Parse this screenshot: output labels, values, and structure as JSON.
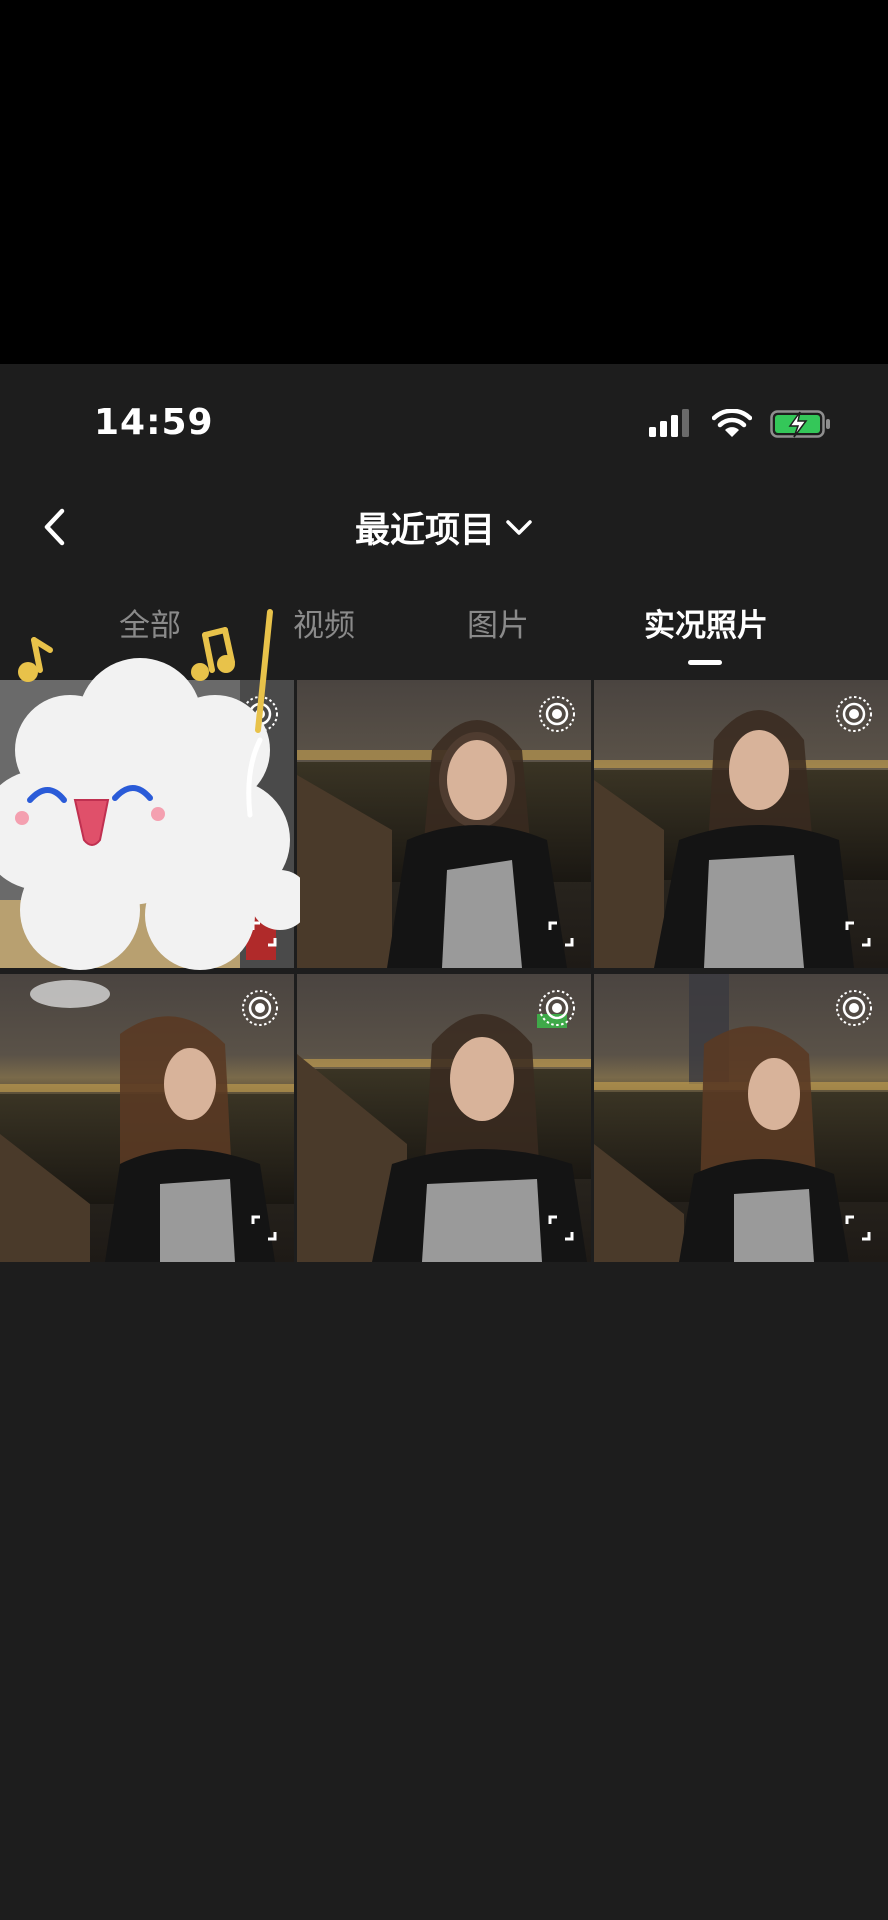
{
  "status_bar": {
    "time": "14:59",
    "icons": [
      "cellular-signal-icon",
      "wifi-icon",
      "battery-charging-icon"
    ],
    "battery_color": "#34c759"
  },
  "nav": {
    "back_icon": "chevron-left-icon",
    "title": "最近项目",
    "title_icon": "chevron-down-icon"
  },
  "tabs": [
    {
      "label": "全部",
      "active": false
    },
    {
      "label": "视频",
      "active": false
    },
    {
      "label": "图片",
      "active": false
    },
    {
      "label": "实况照片",
      "active": true
    }
  ],
  "grid": {
    "items": [
      {
        "kind": "live-photo",
        "badge_icon": "live-photo-icon",
        "expand_icon": "expand-icon",
        "sticker": "cloud-music-sticker"
      },
      {
        "kind": "live-photo",
        "badge_icon": "live-photo-icon",
        "expand_icon": "expand-icon"
      },
      {
        "kind": "live-photo",
        "badge_icon": "live-photo-icon",
        "expand_icon": "expand-icon"
      },
      {
        "kind": "live-photo",
        "badge_icon": "live-photo-icon",
        "expand_icon": "expand-icon"
      },
      {
        "kind": "live-photo",
        "badge_icon": "live-photo-icon",
        "expand_icon": "expand-icon"
      },
      {
        "kind": "live-photo",
        "badge_icon": "live-photo-icon",
        "expand_icon": "expand-icon"
      }
    ]
  },
  "colors": {
    "background": "#1d1d1d",
    "active_tab": "#ffffff",
    "inactive_tab": "#8a8a8a",
    "sticker_accent": "#e8c24a"
  }
}
